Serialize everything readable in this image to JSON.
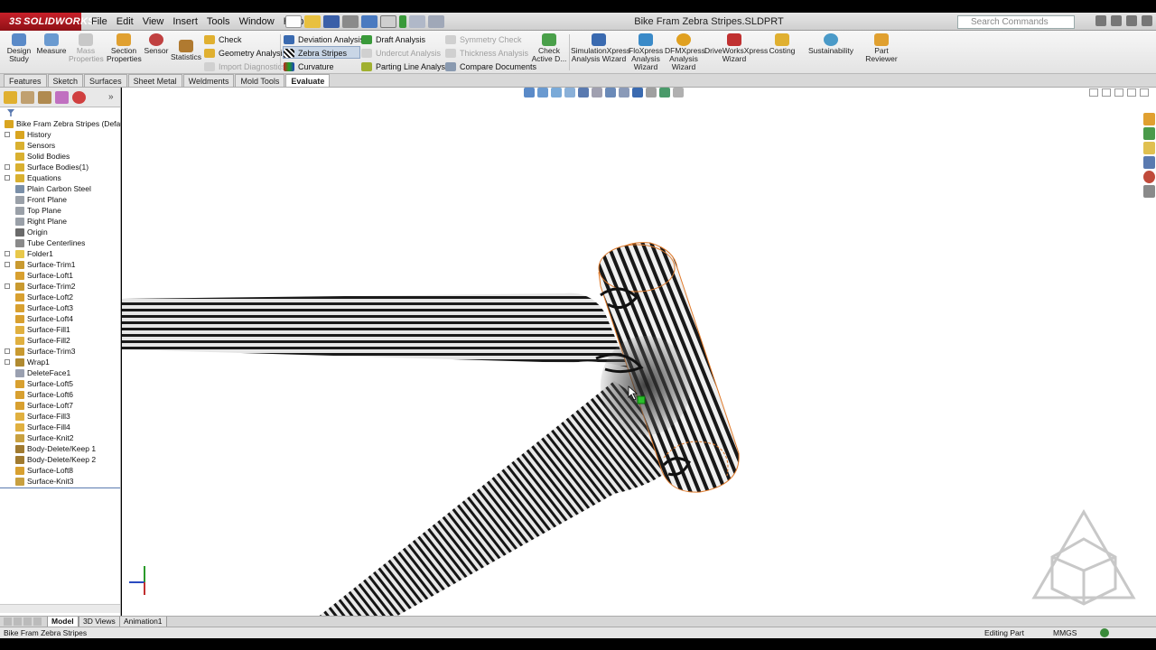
{
  "app": {
    "brand": "SOLIDWORKS",
    "document_title": "Bike Fram Zebra Stripes.SLDPRT *",
    "search_placeholder": "Search Commands"
  },
  "menu": [
    "File",
    "Edit",
    "View",
    "Insert",
    "Tools",
    "Window",
    "Help"
  ],
  "ribbon": {
    "design_study": "Design Study",
    "measure": "Measure",
    "mass_properties": "Mass Properties",
    "section_properties": "Section Properties",
    "sensor": "Sensor",
    "statistics": "Statistics",
    "check": "Check",
    "geometry_analysis": "Geometry Analysis",
    "import_diagnostics": "Import Diagnostics",
    "deviation_analysis": "Deviation Analysis",
    "zebra_stripes": "Zebra Stripes",
    "curvature": "Curvature",
    "draft_analysis": "Draft Analysis",
    "undercut_analysis": "Undercut Analysis",
    "parting_line_analysis": "Parting Line Analysis",
    "symmetry_check": "Symmetry Check",
    "thickness_analysis": "Thickness Analysis",
    "compare_documents": "Compare Documents",
    "check_active_document": "Check Active D...",
    "simulationxpress": "SimulationXpress Analysis Wizard",
    "floxpress": "FloXpress Analysis Wizard",
    "dfmxpress": "DFMXpress Analysis Wizard",
    "driveworksxpress": "DriveWorksXpress Wizard",
    "costing": "Costing",
    "sustainability": "Sustainability",
    "part_reviewer": "Part Reviewer"
  },
  "tabs": [
    "Features",
    "Sketch",
    "Surfaces",
    "Sheet Metal",
    "Weldments",
    "Mold Tools",
    "Evaluate"
  ],
  "active_tab": "Evaluate",
  "tree": {
    "root": "Bike Fram Zebra Stripes  (Default",
    "items": [
      {
        "label": "History",
        "exp": true,
        "color": "#d9a520"
      },
      {
        "label": "Sensors",
        "exp": false,
        "color": "#d9b030"
      },
      {
        "label": "Solid Bodies",
        "exp": false,
        "color": "#d9b030"
      },
      {
        "label": "Surface Bodies(1)",
        "exp": true,
        "color": "#d9b030"
      },
      {
        "label": "Equations",
        "exp": true,
        "color": "#d9b030"
      },
      {
        "label": "Plain Carbon Steel",
        "exp": false,
        "color": "#7a8fa8"
      },
      {
        "label": "Front Plane",
        "exp": false,
        "color": "#9aa0a8"
      },
      {
        "label": "Top Plane",
        "exp": false,
        "color": "#9aa0a8"
      },
      {
        "label": "Right Plane",
        "exp": false,
        "color": "#9aa0a8"
      },
      {
        "label": "Origin",
        "exp": false,
        "color": "#6a6a6a"
      },
      {
        "label": "Tube Centerlines",
        "exp": false,
        "color": "#8a8a8a"
      },
      {
        "label": "Folder1",
        "exp": true,
        "color": "#e8c84a"
      },
      {
        "label": "Surface-Trim1",
        "exp": true,
        "color": "#c99a30"
      },
      {
        "label": "Surface-Loft1",
        "exp": false,
        "color": "#d8a030"
      },
      {
        "label": "Surface-Trim2",
        "exp": true,
        "color": "#c99a30"
      },
      {
        "label": "Surface-Loft2",
        "exp": false,
        "color": "#d8a030"
      },
      {
        "label": "Surface-Loft3",
        "exp": false,
        "color": "#d8a030"
      },
      {
        "label": "Surface-Loft4",
        "exp": false,
        "color": "#d8a030"
      },
      {
        "label": "Surface-Fill1",
        "exp": false,
        "color": "#e0b040"
      },
      {
        "label": "Surface-Fill2",
        "exp": false,
        "color": "#e0b040"
      },
      {
        "label": "Surface-Trim3",
        "exp": true,
        "color": "#c99a30"
      },
      {
        "label": "Wrap1",
        "exp": true,
        "color": "#b08a30"
      },
      {
        "label": "DeleteFace1",
        "exp": false,
        "color": "#9aa0b0"
      },
      {
        "label": "Surface-Loft5",
        "exp": false,
        "color": "#d8a030"
      },
      {
        "label": "Surface-Loft6",
        "exp": false,
        "color": "#d8a030"
      },
      {
        "label": "Surface-Loft7",
        "exp": false,
        "color": "#d8a030"
      },
      {
        "label": "Surface-Fill3",
        "exp": false,
        "color": "#e0b040"
      },
      {
        "label": "Surface-Fill4",
        "exp": false,
        "color": "#e0b040"
      },
      {
        "label": "Surface-Knit2",
        "exp": false,
        "color": "#c8a040"
      },
      {
        "label": "Body-Delete/Keep 1",
        "exp": false,
        "color": "#a07a30"
      },
      {
        "label": "Body-Delete/Keep 2",
        "exp": false,
        "color": "#a07a30"
      },
      {
        "label": "Surface-Loft8",
        "exp": false,
        "color": "#d8a030"
      },
      {
        "label": "Surface-Knit3",
        "exp": false,
        "color": "#c8a040"
      }
    ]
  },
  "bottom_tabs": [
    "Model",
    "3D Views",
    "Animation1"
  ],
  "status": {
    "document": "Bike Fram Zebra Stripes",
    "mode": "Editing Part",
    "units": "MMGS"
  },
  "colors": {
    "brand_red": "#c8202a",
    "selection_orange": "#e07a2a",
    "selected_tab_bg": "#c9d6e6"
  }
}
